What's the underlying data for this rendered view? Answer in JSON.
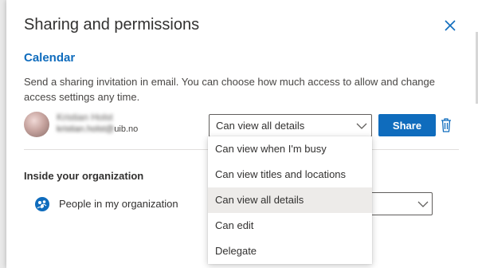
{
  "dialog": {
    "title": "Sharing and permissions",
    "section_title": "Calendar",
    "description": "Send a sharing invitation in email. You can choose how much access to allow and change access settings any time."
  },
  "invitee": {
    "name": "Kristian Holst",
    "email_prefix": "kristian.holst@",
    "email_suffix": "uib.no",
    "permission": "Can view all details"
  },
  "actions": {
    "share_label": "Share"
  },
  "organization": {
    "section_title": "Inside your organization",
    "group_label": "People in my organization"
  },
  "dropdown": {
    "options": [
      "Can view when I'm busy",
      "Can view titles and locations",
      "Can view all details",
      "Can edit",
      "Delegate"
    ],
    "selected": "Can view all details"
  },
  "icons": {
    "close": "close-icon",
    "chevron": "chevron-down-icon",
    "delete": "trash-icon",
    "organization": "organization-icon"
  },
  "colors": {
    "accent": "#0f6cbd",
    "selected_option": "#edebe9"
  }
}
